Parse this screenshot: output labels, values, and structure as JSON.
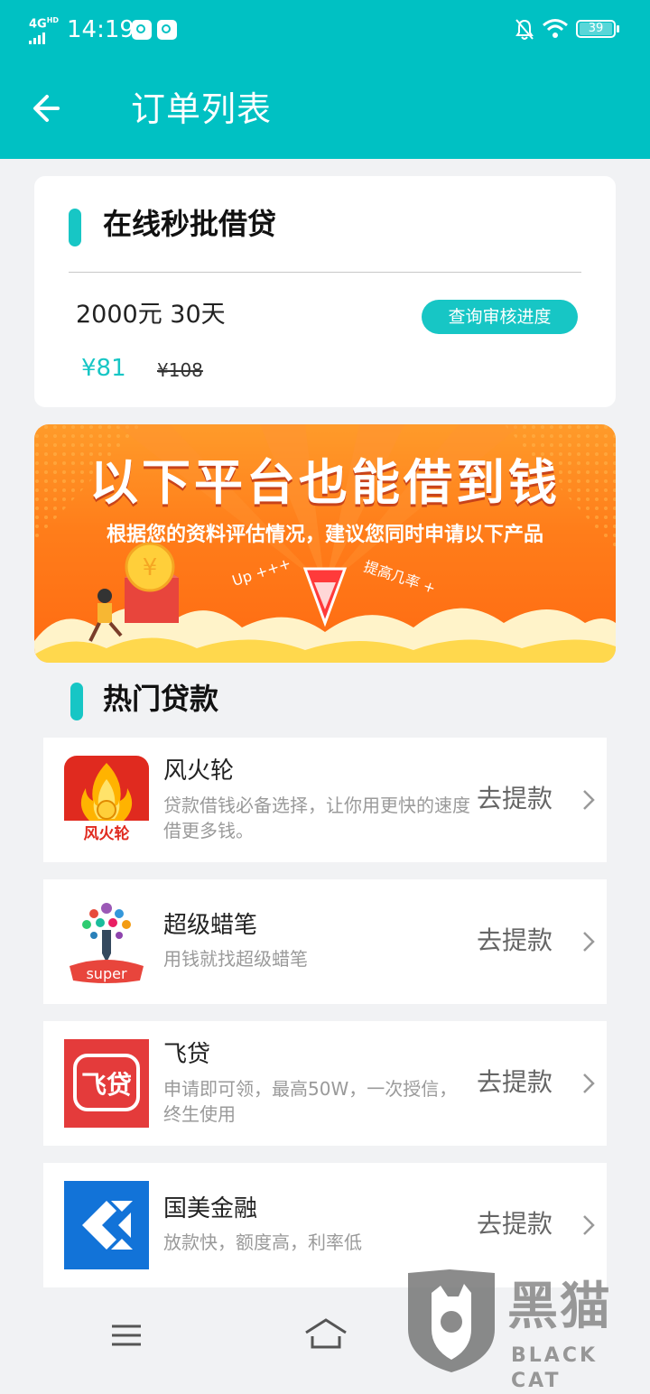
{
  "status_bar": {
    "network": "4G",
    "network_tag": "HD",
    "time": "14:19",
    "battery": "39"
  },
  "header": {
    "title": "订单列表"
  },
  "order": {
    "section_title": "在线秒批借贷",
    "description": "2000元 30天",
    "check_button": "查询审核进度",
    "price": "¥81",
    "original_price": "¥108"
  },
  "banner": {
    "title": "以下平台也能借到钱",
    "subtitle": "根据您的资料评估情况，建议您同时申请以下产品",
    "left_tag": "Up +++",
    "right_tag": "提高几率 +"
  },
  "hot_loans": {
    "title": "热门贷款",
    "items": [
      {
        "name": "风火轮",
        "desc": "贷款借钱必备选择，让你用更快的速度借更多钱。",
        "action": "去提款",
        "logo_text": "风火轮",
        "icon": "fire-wheel-logo-icon"
      },
      {
        "name": "超级蜡笔",
        "desc": "用钱就找超级蜡笔",
        "action": "去提款",
        "logo_text": "super",
        "icon": "super-crayon-logo-icon"
      },
      {
        "name": "飞贷",
        "desc": "申请即可领，最高50W，一次授信，终生使用",
        "action": "去提款",
        "logo_text": "飞贷",
        "icon": "feidai-logo-icon"
      },
      {
        "name": "国美金融",
        "desc": "放款快，额度高，利率低",
        "action": "去提款",
        "logo_text": "",
        "icon": "gome-finance-logo-icon"
      }
    ]
  },
  "watermark": {
    "text": "黑猫",
    "sub": "BLACK CAT"
  },
  "colors": {
    "teal": "#00c1c3",
    "accent": "#17c6c5",
    "banner_orange": "#ff7d1a",
    "feidai_red": "#e43b3b",
    "gome_blue": "#1273d8"
  }
}
